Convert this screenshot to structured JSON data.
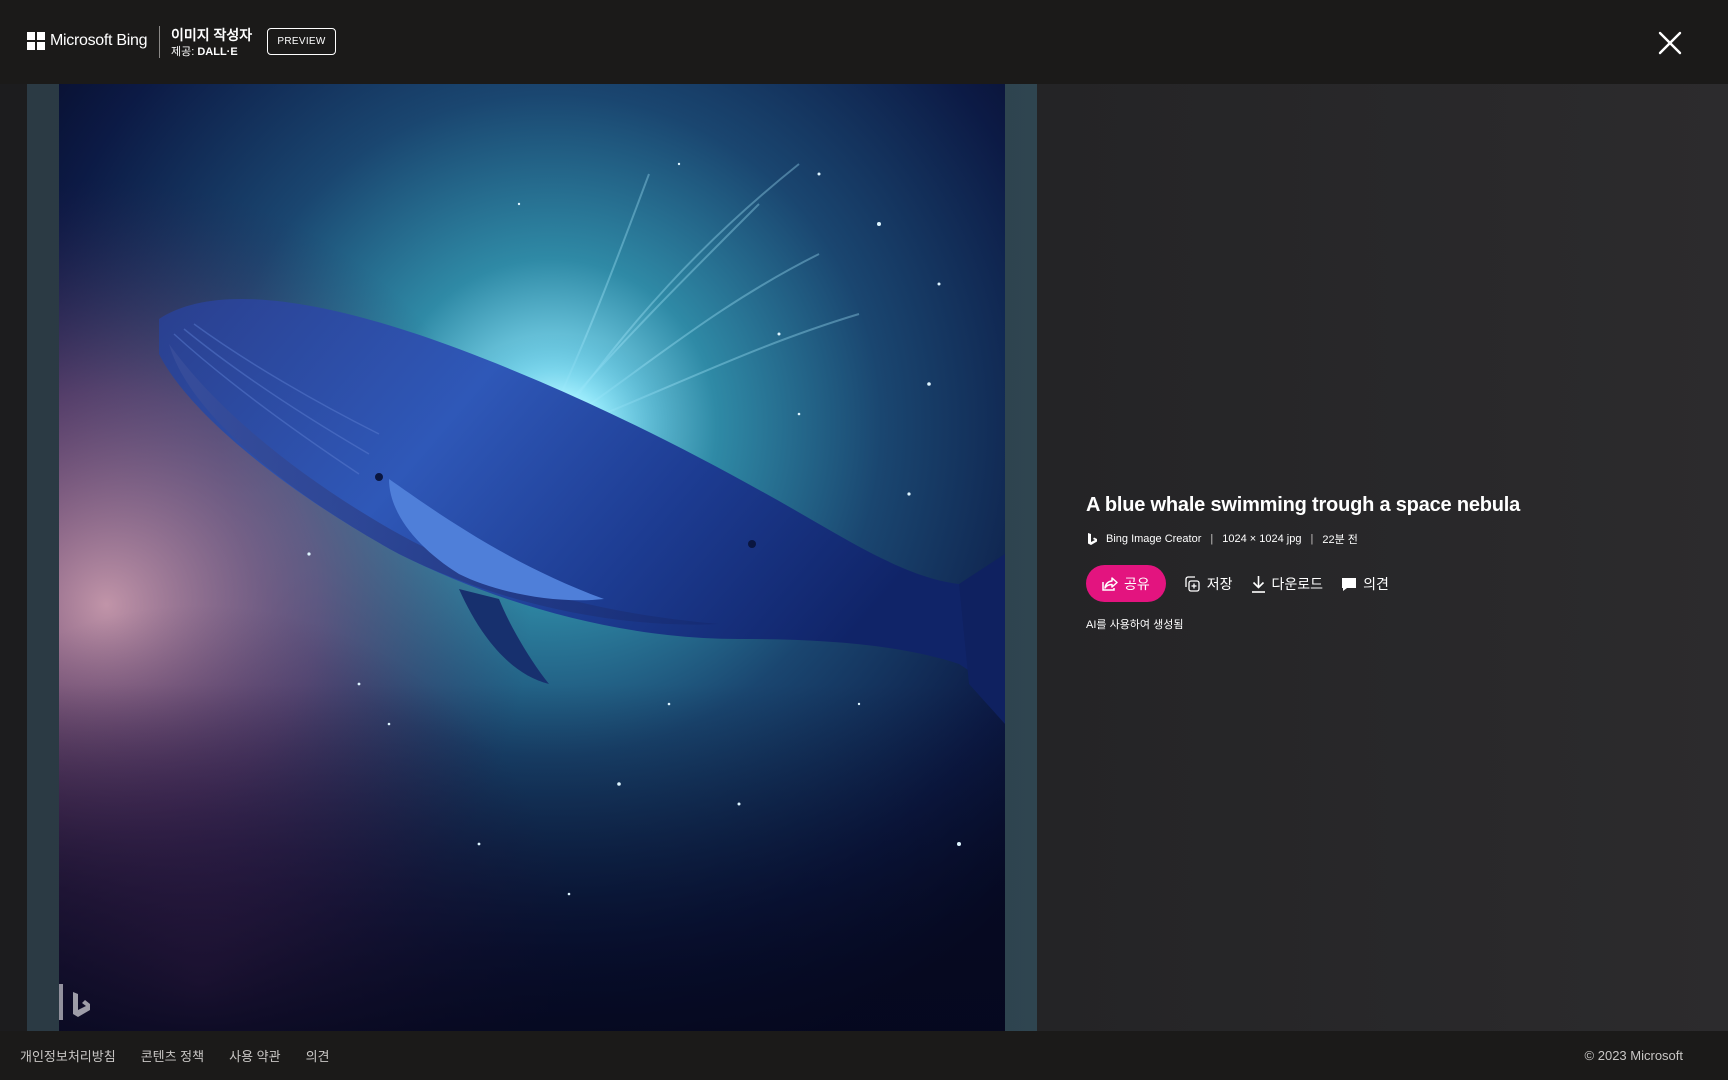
{
  "header": {
    "brand_name": "Microsoft Bing",
    "product_title": "이미지 작성자",
    "provider_prefix": "제공:",
    "provider_name": "DALL·E",
    "preview_badge": "PREVIEW"
  },
  "image": {
    "title": "A blue whale swimming trough a space nebula",
    "creator": "Bing Image Creator",
    "dimensions": "1024 × 1024 jpg",
    "age": "22분 전"
  },
  "actions": {
    "share": "공유",
    "save": "저장",
    "download": "다운로드",
    "feedback": "의견"
  },
  "ai_note": "AI를 사용하여 생성됨",
  "footer": {
    "links": [
      "개인정보처리방침",
      "콘텐츠 정책",
      "사용 약관",
      "의견"
    ],
    "copyright": "© 2023 Microsoft"
  },
  "colors": {
    "accent": "#e3147f",
    "background": "#1b1a19"
  },
  "icons": {
    "close": "close-icon",
    "share": "share-icon",
    "save": "save-collection-icon",
    "download": "download-icon",
    "feedback": "feedback-icon"
  }
}
